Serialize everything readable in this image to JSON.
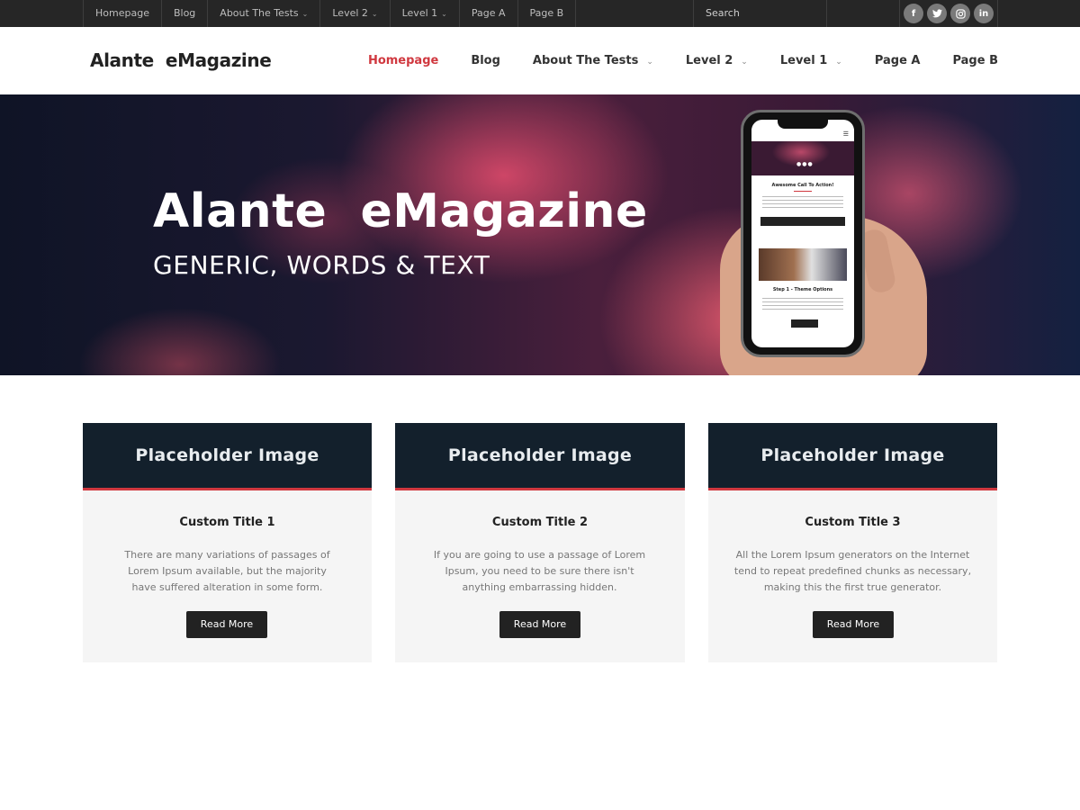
{
  "topbar": {
    "nav": [
      {
        "label": "Homepage",
        "dropdown": false
      },
      {
        "label": "Blog",
        "dropdown": false
      },
      {
        "label": "About The Tests",
        "dropdown": true
      },
      {
        "label": "Level 2",
        "dropdown": true
      },
      {
        "label": "Level 1",
        "dropdown": true
      },
      {
        "label": "Page A",
        "dropdown": false
      },
      {
        "label": "Page B",
        "dropdown": false
      }
    ],
    "search_placeholder": "Search",
    "social": [
      {
        "icon": "facebook-icon",
        "glyph": "f"
      },
      {
        "icon": "twitter-icon",
        "glyph": "t"
      },
      {
        "icon": "instagram-icon",
        "glyph": "◎"
      },
      {
        "icon": "linkedin-icon",
        "glyph": "in"
      }
    ]
  },
  "header": {
    "logo": "Alante  eMagazine",
    "nav": [
      {
        "label": "Homepage",
        "active": true
      },
      {
        "label": "Blog"
      },
      {
        "label": "About The Tests",
        "dropdown": true
      },
      {
        "label": "Level 2",
        "dropdown": true
      },
      {
        "label": "Level 1",
        "dropdown": true
      },
      {
        "label": "Page A"
      },
      {
        "label": "Page B"
      }
    ]
  },
  "hero": {
    "title": "Alante  eMagazine",
    "subtitle": "GENERIC, WORDS & TEXT",
    "phone_screen": {
      "heading": "Awesome Call To Action!",
      "button": "Read More",
      "section_heading": "Step 1 - Theme Options",
      "section_button": "Read More"
    }
  },
  "cards": [
    {
      "image_label": "Placeholder Image",
      "title": "Custom Title 1",
      "text": "There are many variations of passages of Lorem Ipsum available, but the majority have suffered alteration in some form.",
      "button": "Read More"
    },
    {
      "image_label": "Placeholder Image",
      "title": "Custom Title 2",
      "text": "If you are going to use a passage of Lorem Ipsum, you need to be sure there isn't anything embarrassing hidden.",
      "button": "Read More"
    },
    {
      "image_label": "Placeholder Image",
      "title": "Custom Title 3",
      "text": "All the Lorem Ipsum generators on the Internet tend to repeat predefined chunks as necessary, making this the first true generator.",
      "button": "Read More"
    }
  ],
  "colors": {
    "accent": "#d0383f",
    "topbar_bg": "#262626",
    "card_image_bg": "#13202c",
    "button_bg": "#222222"
  }
}
